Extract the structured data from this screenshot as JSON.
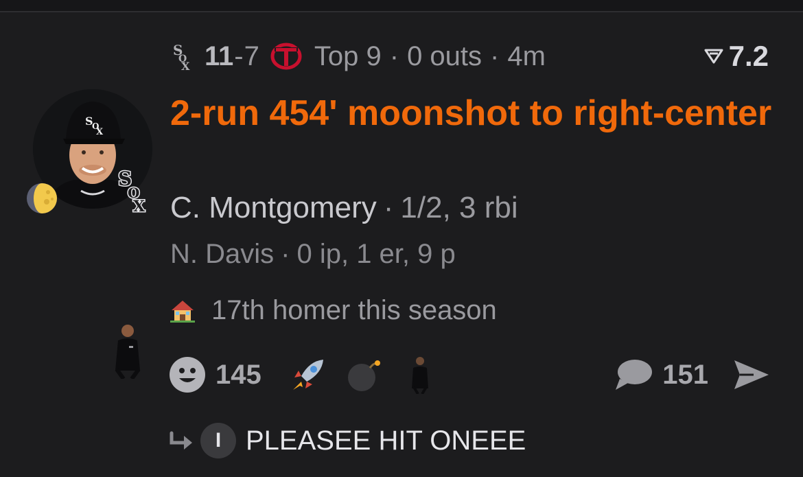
{
  "game": {
    "away_score": "11",
    "score_separator": "-",
    "home_score": "7",
    "inning": "Top 9",
    "outs": "0 outs",
    "elapsed": "4m",
    "separator": "·",
    "away_icon": "white-sox-logo",
    "home_icon": "twins-logo"
  },
  "rating": {
    "value": "7.2",
    "icon": "rating-triangle-icon"
  },
  "headline": "2-run 454' moonshot to right-center",
  "batter": {
    "name": "C. Montgomery",
    "stats": "1/2, 3 rbi"
  },
  "pitcher": {
    "name": "N. Davis",
    "stats": "0 ip, 1 er, 9 p"
  },
  "note": {
    "icon": "house-icon",
    "text": "17th homer this season"
  },
  "reactions": {
    "count": "145",
    "icons": [
      "smile-icon",
      "rocket-icon",
      "bomb-icon",
      "coach-sticker"
    ]
  },
  "comments": {
    "count": "151"
  },
  "reply": {
    "initial": "I",
    "text": "PLEASEE HIT ONEEE"
  },
  "colors": {
    "accent": "#f0690b",
    "background": "#1c1c1e",
    "muted": "#9a9a9f"
  }
}
